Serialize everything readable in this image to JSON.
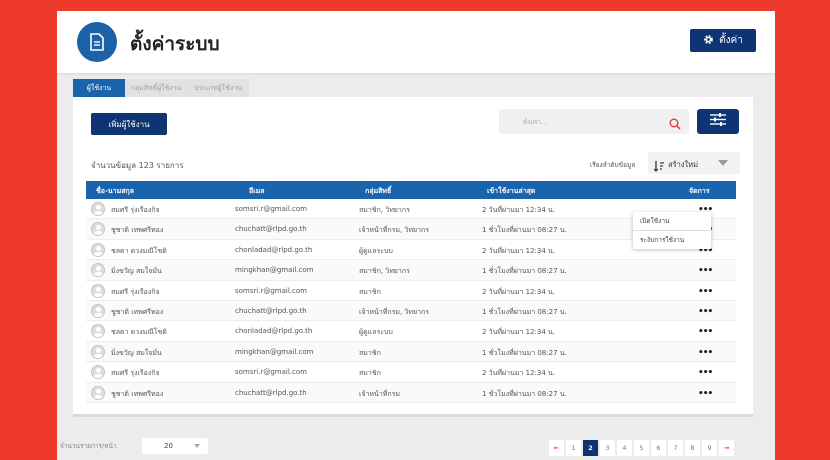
{
  "header": {
    "title": "ตั้งค่าระบบ",
    "settings_label": "ตั้งค่า"
  },
  "tabs": [
    {
      "label": "ผู้ใช้งาน",
      "active": true
    },
    {
      "label": "กลุ่มสิทธิ์ผู้ใช้งาน",
      "active": false
    },
    {
      "label": "ประเภทผู้ใช้งาน",
      "active": false
    }
  ],
  "toolbar": {
    "add_label": "เพิ่มผู้ใช้งาน",
    "search_placeholder": "ค้นหา..."
  },
  "summary": {
    "count_text": "จำนวนข้อมูล 123 รายการ"
  },
  "sort": {
    "label": "เรียงลำดับข้อมูล",
    "value": "สร้างใหม่"
  },
  "table": {
    "headers": [
      "ชื่อ-นามสกุล",
      "อีเมล",
      "กลุ่มสิทธิ์",
      "เข้าใช้งานล่าสุด",
      "จัดการ"
    ],
    "rows": [
      {
        "name": "สมศรี รุ่งเรืองกิจ",
        "email": "somsri.r@gmail.com",
        "group": "สมาชิก, วิทยากร",
        "last": "2 วันที่ผ่านมา 12:34 น."
      },
      {
        "name": "ชูชาติ เทพศรีทอง",
        "email": "chuchatt@rlpd.go.th",
        "group": "เจ้าหน้าที่กรม, วิทยากร",
        "last": "1 ชั่วโมงที่ผ่านมา 08:27 น."
      },
      {
        "name": "ชลดา ดวงมณีโชติ",
        "email": "chonladad@rlpd.go.th",
        "group": "ผู้ดูแลระบบ",
        "last": "2 วันที่ผ่านมา 12:34 น."
      },
      {
        "name": "มิ่งขวัญ สมใจมั่น",
        "email": "mingkhan@gmail.com",
        "group": "สมาชิก, วิทยากร",
        "last": "1 ชั่วโมงที่ผ่านมา 08:27 น."
      },
      {
        "name": "สมศรี รุ่งเรืองกิจ",
        "email": "somsri.r@gmail.com",
        "group": "สมาชิก",
        "last": "2 วันที่ผ่านมา 12:34 น."
      },
      {
        "name": "ชูชาติ เทพศรีทอง",
        "email": "chuchatt@rlpd.go.th",
        "group": "เจ้าหน้าที่กรม, วิทยากร",
        "last": "1 ชั่วโมงที่ผ่านมา 08:27 น."
      },
      {
        "name": "ชลดา ดวงมณีโชติ",
        "email": "chonladad@rlpd.go.th",
        "group": "ผู้ดูแลระบบ",
        "last": "2 วันที่ผ่านมา 12:34 น."
      },
      {
        "name": "มิ่งขวัญ สมใจมั่น",
        "email": "mingkhan@gmail.com",
        "group": "สมาชิก",
        "last": "1 ชั่วโมงที่ผ่านมา 08:27 น."
      },
      {
        "name": "สมศรี รุ่งเรืองกิจ",
        "email": "somsri.r@gmail.com",
        "group": "สมาชิก",
        "last": "2 วันที่ผ่านมา 12:34 น."
      },
      {
        "name": "ชูชาติ เทพศรีทอง",
        "email": "chuchatt@rlpd.go.th",
        "group": "เจ้าหน้าที่กรม",
        "last": "1 ชั่วโมงที่ผ่านมา 08:27 น."
      }
    ],
    "action_icon": "more-horizontal-icon"
  },
  "context_menu": {
    "items": [
      "เปิดใช้งาน",
      "ระงับการใช้งาน"
    ]
  },
  "footer": {
    "page_size_label": "จำนวนรายการ/หน้า",
    "page_size_value": "20",
    "pages": [
      "1",
      "2",
      "3",
      "4",
      "5",
      "6",
      "7",
      "8",
      "9"
    ],
    "current_page": "2",
    "prev_icon": "arrow-left-icon",
    "next_icon": "arrow-right-icon"
  },
  "colors": {
    "primary": "#0f3473",
    "accent": "#1a64ae",
    "background": "#ee3a2d"
  }
}
